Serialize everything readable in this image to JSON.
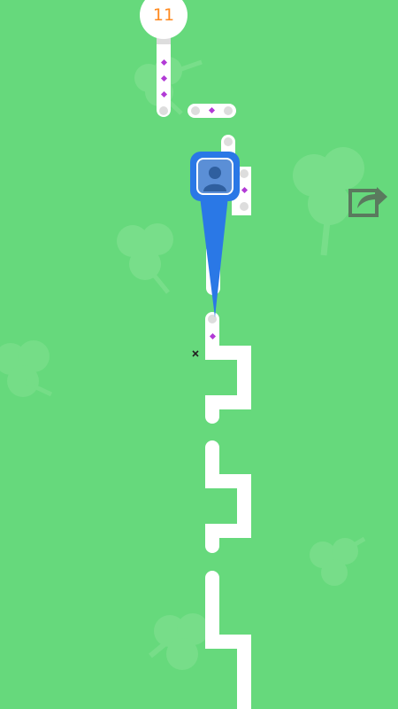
{
  "hud": {
    "score": "11"
  },
  "icons": {
    "share": "share-icon",
    "avatar": "user-avatar-icon",
    "clover": "clover-icon",
    "crosshair": "crosshair-icon"
  },
  "colors": {
    "background": "#66d97c",
    "path": "#ffffff",
    "gem": "#b23ad6",
    "score_text": "#ff8a1f",
    "pointer": "#2a78e6"
  }
}
